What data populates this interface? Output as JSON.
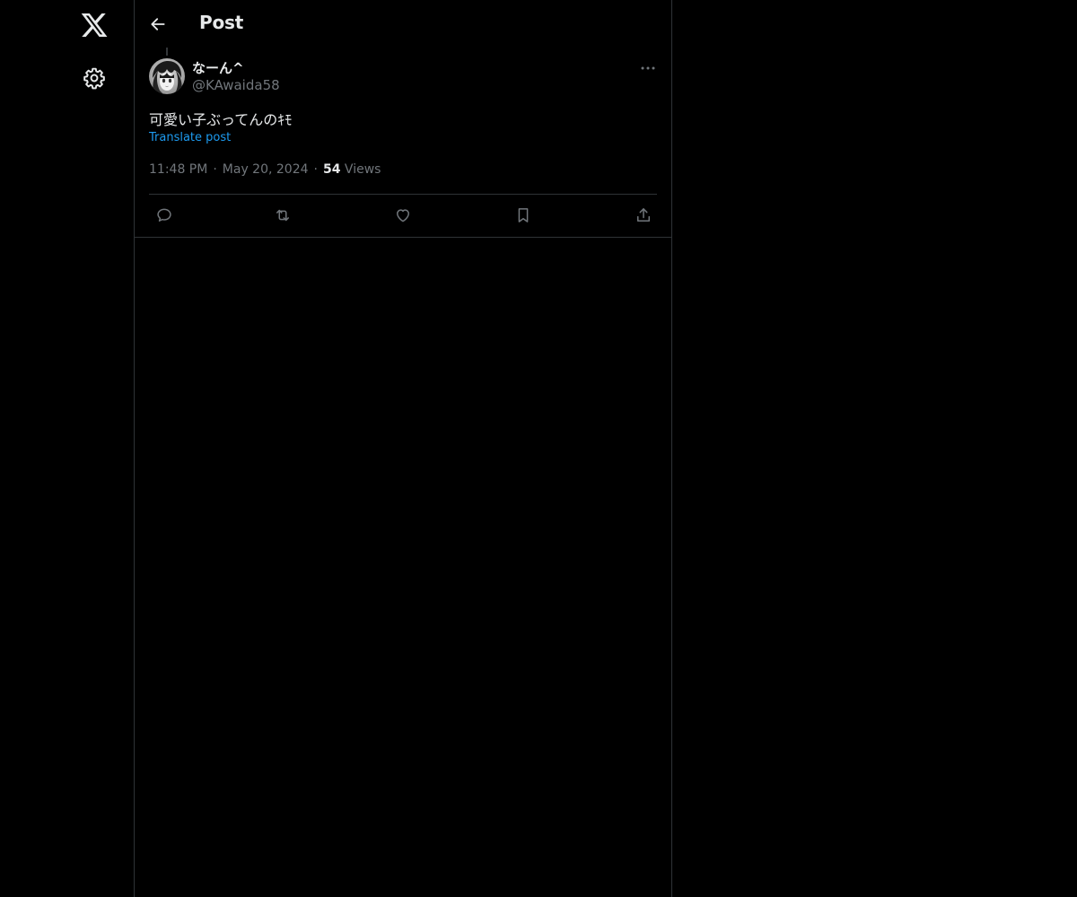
{
  "header": {
    "title": "Post",
    "back_icon": "arrow-left-icon"
  },
  "nav": {
    "logo_icon": "x-logo-icon",
    "settings_icon": "gear-icon"
  },
  "post": {
    "author": {
      "display_name": "なーん^",
      "handle": "@KAwaida58"
    },
    "text": "可愛い子ぶってんのｷﾓ",
    "translate_label": "Translate post",
    "time": "11:48 PM",
    "date": "May 20, 2024",
    "views_count": "54",
    "views_label": "Views",
    "more_icon": "more-horizontal-icon"
  },
  "actions": [
    {
      "name": "reply",
      "icon": "reply-icon"
    },
    {
      "name": "repost",
      "icon": "repost-icon"
    },
    {
      "name": "like",
      "icon": "heart-icon"
    },
    {
      "name": "bookmark",
      "icon": "bookmark-icon"
    },
    {
      "name": "share",
      "icon": "share-icon"
    }
  ],
  "colors": {
    "background": "#000000",
    "text_primary": "#e7e9ea",
    "text_secondary": "#71767b",
    "link": "#1d9bf0",
    "border": "#2f3336"
  }
}
